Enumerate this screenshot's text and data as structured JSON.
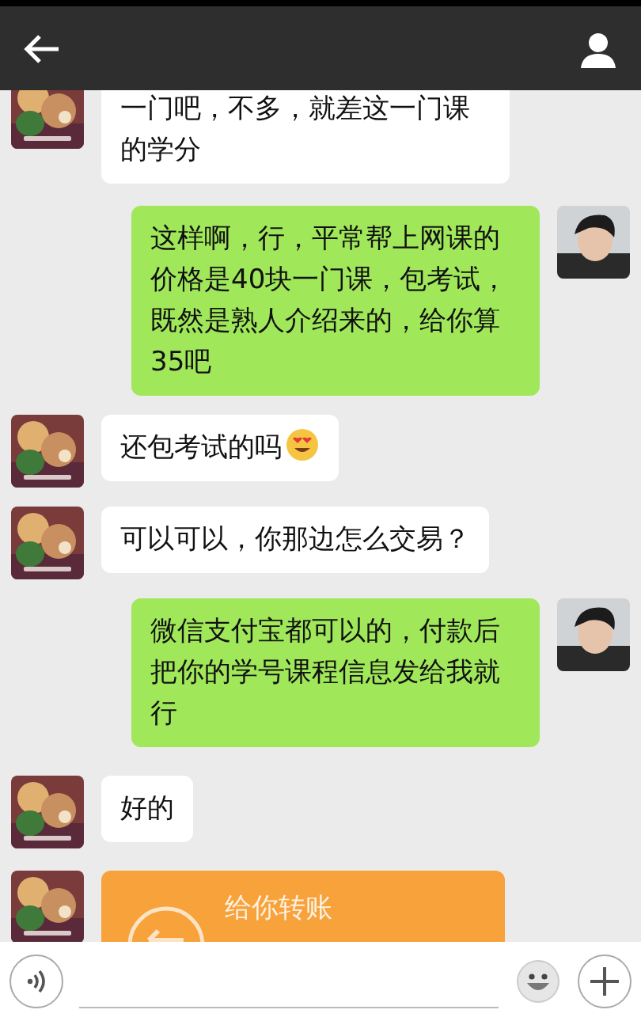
{
  "messages": [
    {
      "kind": "text",
      "outgoing": false,
      "text": "一门吧，不多，就差这一门课的学分",
      "emoji": false
    },
    {
      "kind": "text",
      "outgoing": true,
      "text": "这样啊，行，平常帮上网课的价格是40块一门课，包考试，既然是熟人介绍来的，给你算35吧",
      "emoji": false
    },
    {
      "kind": "text",
      "outgoing": false,
      "text": "还包考试的吗",
      "emoji": true
    },
    {
      "kind": "text",
      "outgoing": false,
      "text": "可以可以，你那边怎么交易？",
      "emoji": false
    },
    {
      "kind": "text",
      "outgoing": true,
      "text": "微信支付宝都可以的，付款后把你的学号课程信息发给我就行",
      "emoji": false
    },
    {
      "kind": "text",
      "outgoing": false,
      "text": "好的",
      "emoji": false
    },
    {
      "kind": "transfer",
      "outgoing": false,
      "text": "给你转账"
    }
  ]
}
